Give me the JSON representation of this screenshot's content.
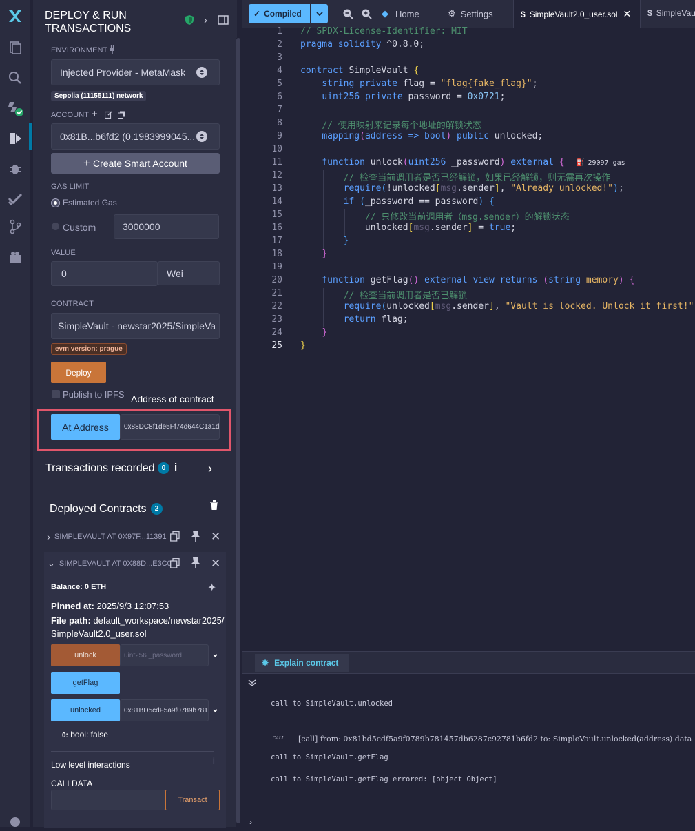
{
  "panel": {
    "title_line1": "DEPLOY & RUN",
    "title_line2": "TRANSACTIONS",
    "environment_label": "ENVIRONMENT",
    "environment_value": "Injected Provider - MetaMask",
    "network_badge": "Sepolia (11155111) network",
    "account_label": "ACCOUNT",
    "account_value": "0x81B...b6fd2 (0.1983999045...",
    "create_smart_account": "Create Smart Account",
    "gas_limit_label": "GAS LIMIT",
    "estimated_gas": "Estimated Gas",
    "custom": "Custom",
    "custom_gas_value": "3000000",
    "value_label": "VALUE",
    "value_amount": "0",
    "value_unit": "Wei",
    "contract_label": "CONTRACT",
    "contract_value": "SimpleVault - newstar2025/SimpleVa",
    "evm_badge": "evm version: prague",
    "deploy_button": "Deploy",
    "publish_ipfs": "Publish to IPFS",
    "address_annotation": "Address of contract",
    "at_address_button": "At Address",
    "at_address_value": "0x88DC8f1de5Ff74d644C1a1de",
    "transactions_recorded": "Transactions recorded",
    "transactions_count": "0",
    "deployed_contracts": "Deployed Contracts",
    "deployed_count": "2",
    "instance1": "SIMPLEVAULT AT 0X97F...11391",
    "instance2": "SIMPLEVAULT AT 0X88D...E3C0",
    "balance": "Balance: 0 ETH",
    "pinned_label": "Pinned at:",
    "pinned_value": "2025/9/3 12:07:53",
    "filepath_label": "File path:",
    "filepath_value1": "default_workspace/newstar2025/",
    "filepath_value2": "SimpleVault2.0_user.sol",
    "unlock_button": "unlock",
    "unlock_placeholder": "uint256 _password",
    "getflag_button": "getFlag",
    "unlocked_button": "unlocked",
    "unlocked_input": "0x81BD5cdF5a9f0789b7814",
    "result_index": "0:",
    "result_value": "bool: false",
    "low_level": "Low level interactions",
    "calldata": "CALLDATA",
    "transact_button": "Transact"
  },
  "tabs": {
    "compiled": "Compiled",
    "home": "Home",
    "settings": "Settings",
    "active_file": "SimpleVault2.0_user.sol",
    "next_file": "SimpleVau"
  },
  "editor": {
    "gas_hint": "29097 gas",
    "lines": [
      "1",
      "2",
      "3",
      "4",
      "5",
      "6",
      "7",
      "8",
      "9",
      "10",
      "11",
      "12",
      "13",
      "14",
      "15",
      "16",
      "17",
      "18",
      "19",
      "20",
      "21",
      "22",
      "23",
      "24",
      "25"
    ]
  },
  "terminal": {
    "explain": "Explain contract",
    "line1": "call to SimpleVault.unlocked",
    "call_tag": "CALL",
    "call_detail": "[call]  from: 0x81bd5cdf5a9f0789b781457db6287c92781b6fd2 to: SimpleVault.unlocked(address) data",
    "line3": "call to SimpleVault.getFlag",
    "line4": "call to SimpleVault.getFlag errored: [object Object]"
  },
  "colors": {
    "accent": "#007aa6",
    "deploy_orange": "#c97539",
    "call_blue": "#5bb8ff",
    "highlight_red": "#e0566b"
  }
}
